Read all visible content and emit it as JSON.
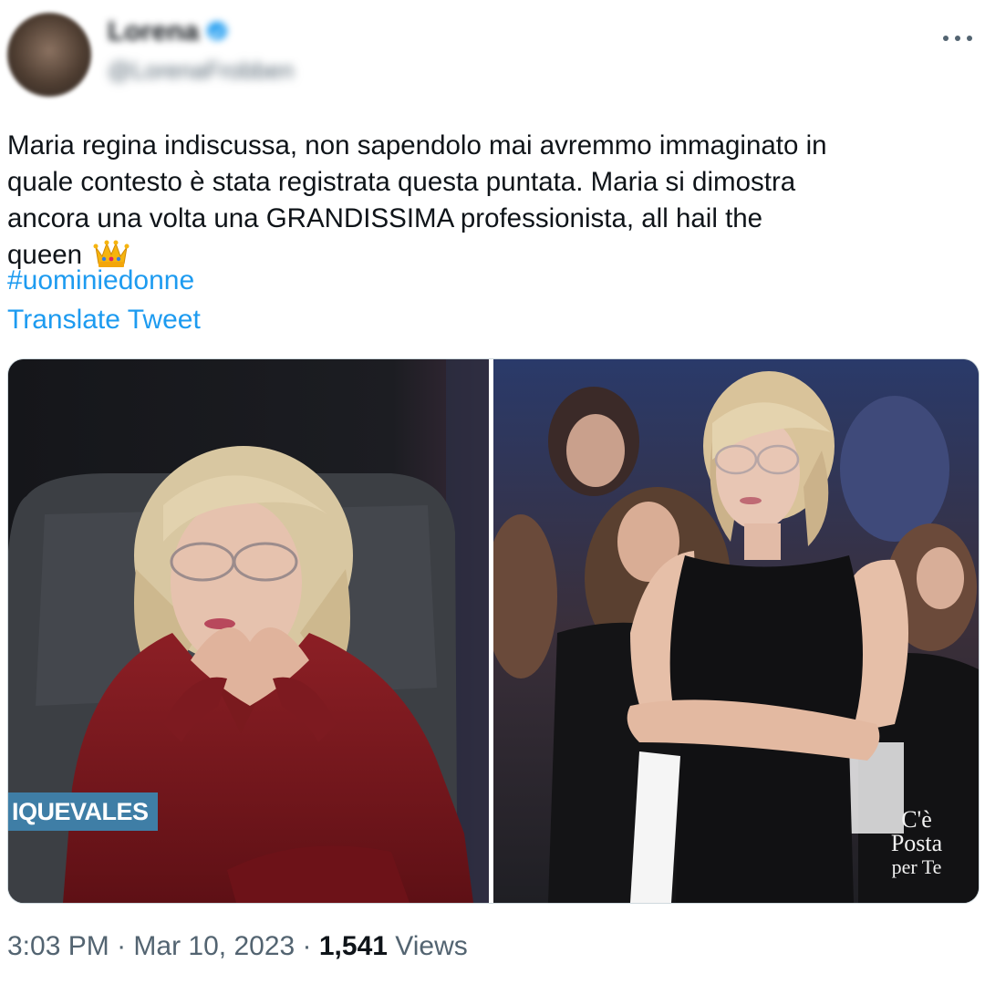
{
  "tweet": {
    "author": {
      "display_name": "Lorena",
      "handle": "@LorenaFrobben",
      "verified_icon": "verified-badge-icon"
    },
    "more_icon": "more-horizontal-icon",
    "text_lines": [
      "Maria regina indiscussa, non sapendolo mai avremmo immaginato in",
      "quale contesto è stata registrata questa puntata. Maria si dimostra",
      "ancora una volta una GRANDISSIMA professionista, all hail the",
      "queen"
    ],
    "emoji": "crown-icon",
    "hashtag": "#uominiedonne",
    "translate": "Translate Tweet",
    "media": {
      "left_overlay": "IQUEVALES",
      "right_logo": [
        "C'è",
        "Posta",
        "per Te"
      ]
    },
    "meta": {
      "time": "3:03 PM",
      "sep1": " · ",
      "date": "Mar 10, 2023",
      "sep2": " · ",
      "views_count": "1,541",
      "views_label": " Views"
    }
  },
  "colors": {
    "link": "#1d9bf0",
    "text": "#0f1419",
    "secondary": "#536471",
    "overlay_blue": "#3f7ea6"
  }
}
